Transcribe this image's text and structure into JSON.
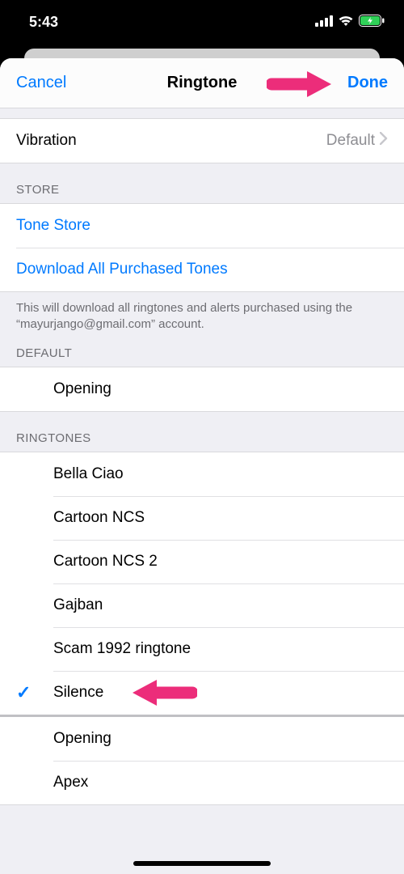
{
  "status": {
    "time": "5:43"
  },
  "nav": {
    "cancel": "Cancel",
    "title": "Ringtone",
    "done": "Done"
  },
  "vibration": {
    "label": "Vibration",
    "value": "Default"
  },
  "sections": {
    "store_header": "STORE",
    "store": {
      "tone_store": "Tone Store",
      "download_all": "Download All Purchased Tones",
      "footer": "This will download all ringtones and alerts purchased using the “mayurjango@gmail.com” account."
    },
    "default_header": "DEFAULT",
    "default_tone": "Opening",
    "ringtones_header": "RINGTONES",
    "ringtones": [
      "Bella Ciao",
      "Cartoon NCS",
      "Cartoon NCS 2",
      "Gajban",
      "Scam 1992 ringtone",
      "Silence"
    ],
    "selected_ringtone": "Silence",
    "more": [
      "Opening",
      "Apex"
    ]
  }
}
